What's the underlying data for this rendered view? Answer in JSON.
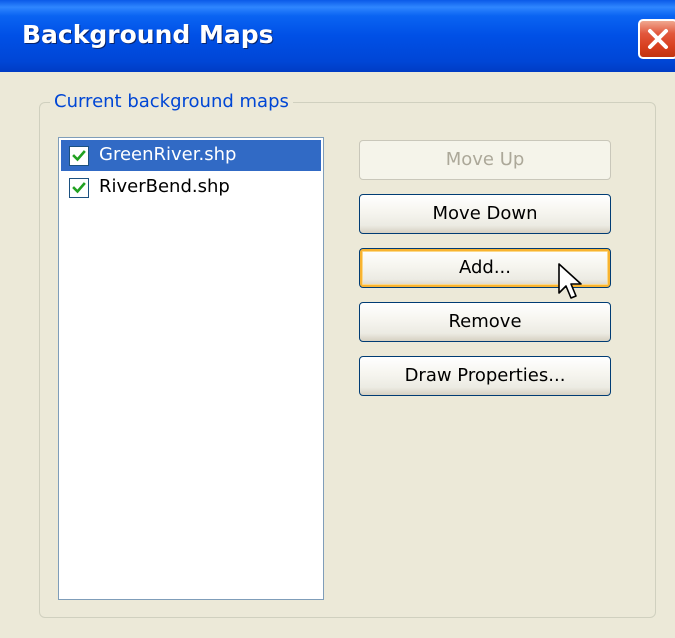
{
  "window": {
    "title": "Background Maps",
    "title_bar_color": "#0054e3",
    "close_icon": "close-x-icon"
  },
  "group": {
    "label": "Current background maps"
  },
  "list": {
    "items": [
      {
        "label": "GreenRiver.shp",
        "checked": true,
        "selected": true
      },
      {
        "label": "RiverBend.shp",
        "checked": true,
        "selected": false
      }
    ]
  },
  "buttons": {
    "move_up": {
      "label": "Move Up",
      "enabled": false
    },
    "move_down": {
      "label": "Move Down",
      "enabled": true
    },
    "add": {
      "label": "Add...",
      "enabled": true,
      "focused": true
    },
    "remove": {
      "label": "Remove",
      "enabled": true
    },
    "draw_properties": {
      "label": "Draw Properties...",
      "enabled": true
    }
  },
  "colors": {
    "selection": "#316ac5",
    "group_label": "#0046d5",
    "dialog_background": "#ece9d8",
    "checkmark": "#21a121"
  }
}
